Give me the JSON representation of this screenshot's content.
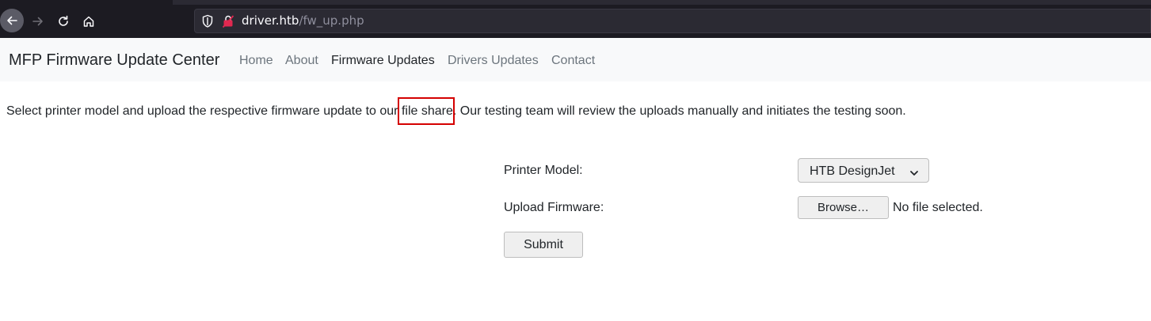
{
  "browser": {
    "url_host": "driver.htb",
    "url_path": "/fw_up.php",
    "icons": [
      "back-arrow-icon",
      "forward-arrow-icon",
      "reload-icon",
      "home-icon",
      "shield-icon",
      "insecure-lock-icon"
    ]
  },
  "site": {
    "brand": "MFP Firmware Update Center",
    "nav": [
      {
        "label": "Home",
        "active": false
      },
      {
        "label": "About",
        "active": false
      },
      {
        "label": "Firmware Updates",
        "active": true
      },
      {
        "label": "Drivers Updates",
        "active": false
      },
      {
        "label": "Contact",
        "active": false
      }
    ]
  },
  "intro": {
    "before": "Select printer model and upload the respective firmware update to our ",
    "highlighted": "file share",
    "after": ". Our testing team will review the uploads manually and initiates the testing soon."
  },
  "form": {
    "printer_model_label": "Printer Model:",
    "printer_model_value": "HTB DesignJet",
    "upload_label": "Upload Firmware:",
    "browse_label": "Browse…",
    "file_status": "No file selected.",
    "submit_label": "Submit"
  },
  "colors": {
    "highlight_box": "#d40000",
    "navbar_bg": "#f8f9fa",
    "chrome_bg": "#1c1b22"
  }
}
